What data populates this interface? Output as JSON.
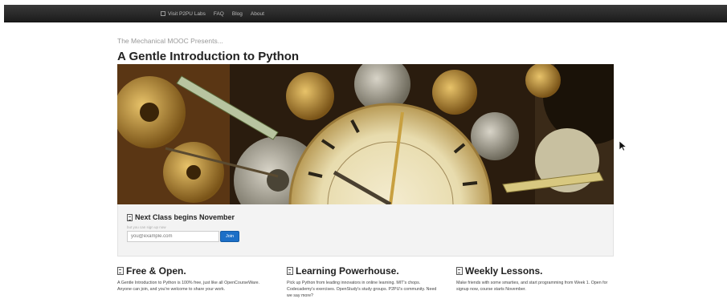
{
  "topnav": {
    "items": [
      "Visit P2PU Labs",
      "FAQ",
      "Blog",
      "About"
    ]
  },
  "header": {
    "presents": "The Mechanical MOOC Presents...",
    "title": "A Gentle Introduction to Python"
  },
  "signup": {
    "heading": "Next Class begins November",
    "hint": "but you can sign up now",
    "email_placeholder": "you@example.com",
    "join_label": "Join"
  },
  "features": [
    {
      "title": "Free & Open.",
      "text": "A Gentle Introduction to Python is 100% free, just like all OpenCourseWare. Anyone can join, and you're welcome to share your work."
    },
    {
      "title": "Learning Powerhouse.",
      "text": "Pick up Python from leading innovators in online learning. MIT's chops. Codecademy's exercises. OpenStudy's study groups. P2PU's community. Need we say more?"
    },
    {
      "title": "Weekly Lessons.",
      "text": "Make friends with some smarties, and start programming from Week 1. Open for signup now, course starts November."
    }
  ],
  "colors": {
    "topbar": "#222222",
    "accent": "#1c6fc7",
    "signup_bg": "#f3f3f3"
  },
  "icons": {
    "hero": "clockwork-gears-image",
    "heading": "document-icon",
    "cursor": "mouse-pointer-icon"
  }
}
